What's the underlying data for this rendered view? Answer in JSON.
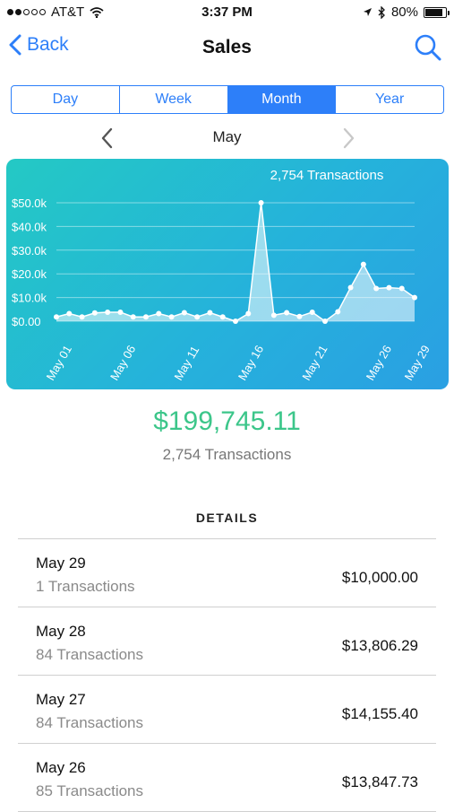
{
  "status_bar": {
    "carrier": "AT&T",
    "time": "3:37 PM",
    "battery": "80%",
    "battery_level": 0.8,
    "signal_bars": 2
  },
  "nav": {
    "back_label": "Back",
    "title": "Sales"
  },
  "segments": [
    "Day",
    "Week",
    "Month",
    "Year"
  ],
  "selected_segment": "Month",
  "month": "May",
  "chart_data": {
    "type": "area",
    "title": "2,754 Transactions",
    "yticks": [
      "$50.0k",
      "$40.0k",
      "$30.0k",
      "$20.0k",
      "$10.0k",
      "$0.00"
    ],
    "ylim": [
      0,
      50000
    ],
    "xticks": [
      "May 01",
      "May 06",
      "May 11",
      "May 16",
      "May 21",
      "May 26",
      "May 29"
    ],
    "x": [
      1,
      2,
      3,
      4,
      5,
      6,
      7,
      8,
      9,
      10,
      11,
      12,
      13,
      14,
      15,
      16,
      17,
      18,
      19,
      20,
      21,
      22,
      23,
      24,
      25,
      26,
      27,
      28,
      29
    ],
    "values": [
      1800,
      3200,
      1800,
      3500,
      3800,
      3800,
      1800,
      1800,
      3200,
      1800,
      3600,
      1800,
      3600,
      1800,
      0,
      3200,
      50000,
      2500,
      3600,
      2000,
      3800,
      0,
      4000,
      14200,
      24000,
      13847.73,
      14155.4,
      13806.29,
      10000
    ],
    "colors": {
      "card_start": "#24c9c4",
      "card_end": "#2a9fe3",
      "line": "#ffffff"
    }
  },
  "summary": {
    "total": "$199,745.11",
    "transactions": "2,754 Transactions"
  },
  "details": {
    "heading": "DETAILS",
    "rows": [
      {
        "date": "May 29",
        "transactions": "1 Transactions",
        "amount": "$10,000.00"
      },
      {
        "date": "May 28",
        "transactions": "84 Transactions",
        "amount": "$13,806.29"
      },
      {
        "date": "May 27",
        "transactions": "84 Transactions",
        "amount": "$14,155.40"
      },
      {
        "date": "May 26",
        "transactions": "85 Transactions",
        "amount": "$13,847.73"
      }
    ]
  },
  "colors": {
    "accent": "#2d7ff9",
    "total_green": "#3cc68a"
  }
}
